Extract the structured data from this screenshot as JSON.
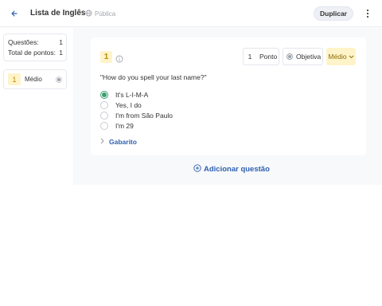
{
  "header": {
    "title": "Lista de Inglês",
    "visibility": "Pública",
    "duplicate_label": "Duplicar"
  },
  "summary": {
    "questions_label": "Questões:",
    "questions_value": "1",
    "points_label": "Total de pontos:",
    "points_value": "1"
  },
  "nav": {
    "items": [
      {
        "number": "1",
        "difficulty": "Médio"
      }
    ]
  },
  "question": {
    "number": "1",
    "points_value": "1",
    "points_label": "Ponto",
    "type_label": "Objetiva",
    "difficulty_label": "Médio",
    "text": "\"How do you spell your last name?\"",
    "options": [
      {
        "label": "It's L-I-M-A",
        "selected": true
      },
      {
        "label": "Yes, I do",
        "selected": false
      },
      {
        "label": "I'm from São Paulo",
        "selected": false
      },
      {
        "label": "I'm 29",
        "selected": false
      }
    ],
    "answer_key_label": "Gabarito"
  },
  "add_question_label": "Adicionar questão",
  "colors": {
    "accent": "#2f61b0",
    "correct": "#3aa06f",
    "highlight": "#fff3c9"
  }
}
